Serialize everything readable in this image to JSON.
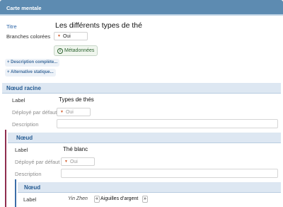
{
  "header": {
    "title": "Carte mentale"
  },
  "form": {
    "title_label": "Titre",
    "title_value": "Les différents types de thé",
    "branches_label": "Branches colorées",
    "branches_value": "Oui",
    "metadata_button": "Métadonnées",
    "metadata_icon": "i",
    "desc_link": "+ Description complète...",
    "alt_link": "+ Alternative statique..."
  },
  "root": {
    "section_title": "Nœud racine",
    "label_label": "Label",
    "label_value": "Types de thés",
    "expanded_label": "Déployé par défaut",
    "expanded_value": "Oui",
    "description_label": "Description"
  },
  "node1": {
    "section_title": "Nœud",
    "label_label": "Label",
    "label_value": "Thé blanc",
    "expanded_label": "Déployé par défaut",
    "expanded_value": "Oui",
    "description_label": "Description"
  },
  "node2": {
    "section_title": "Nœud",
    "label_label": "Label",
    "label_value_a": "Yin Zhen",
    "label_separator": "«",
    "label_value_b": "Aiguilles d’argent",
    "label_close": "»"
  },
  "colors": {
    "header": "#5d8bb1",
    "section_bg": "#dde7f2",
    "node1_bar": "#8f2d4e",
    "node2_bar": "#3b6ea8"
  },
  "icons": {
    "dropdown": "triangle-down-icon",
    "info": "info-icon"
  }
}
